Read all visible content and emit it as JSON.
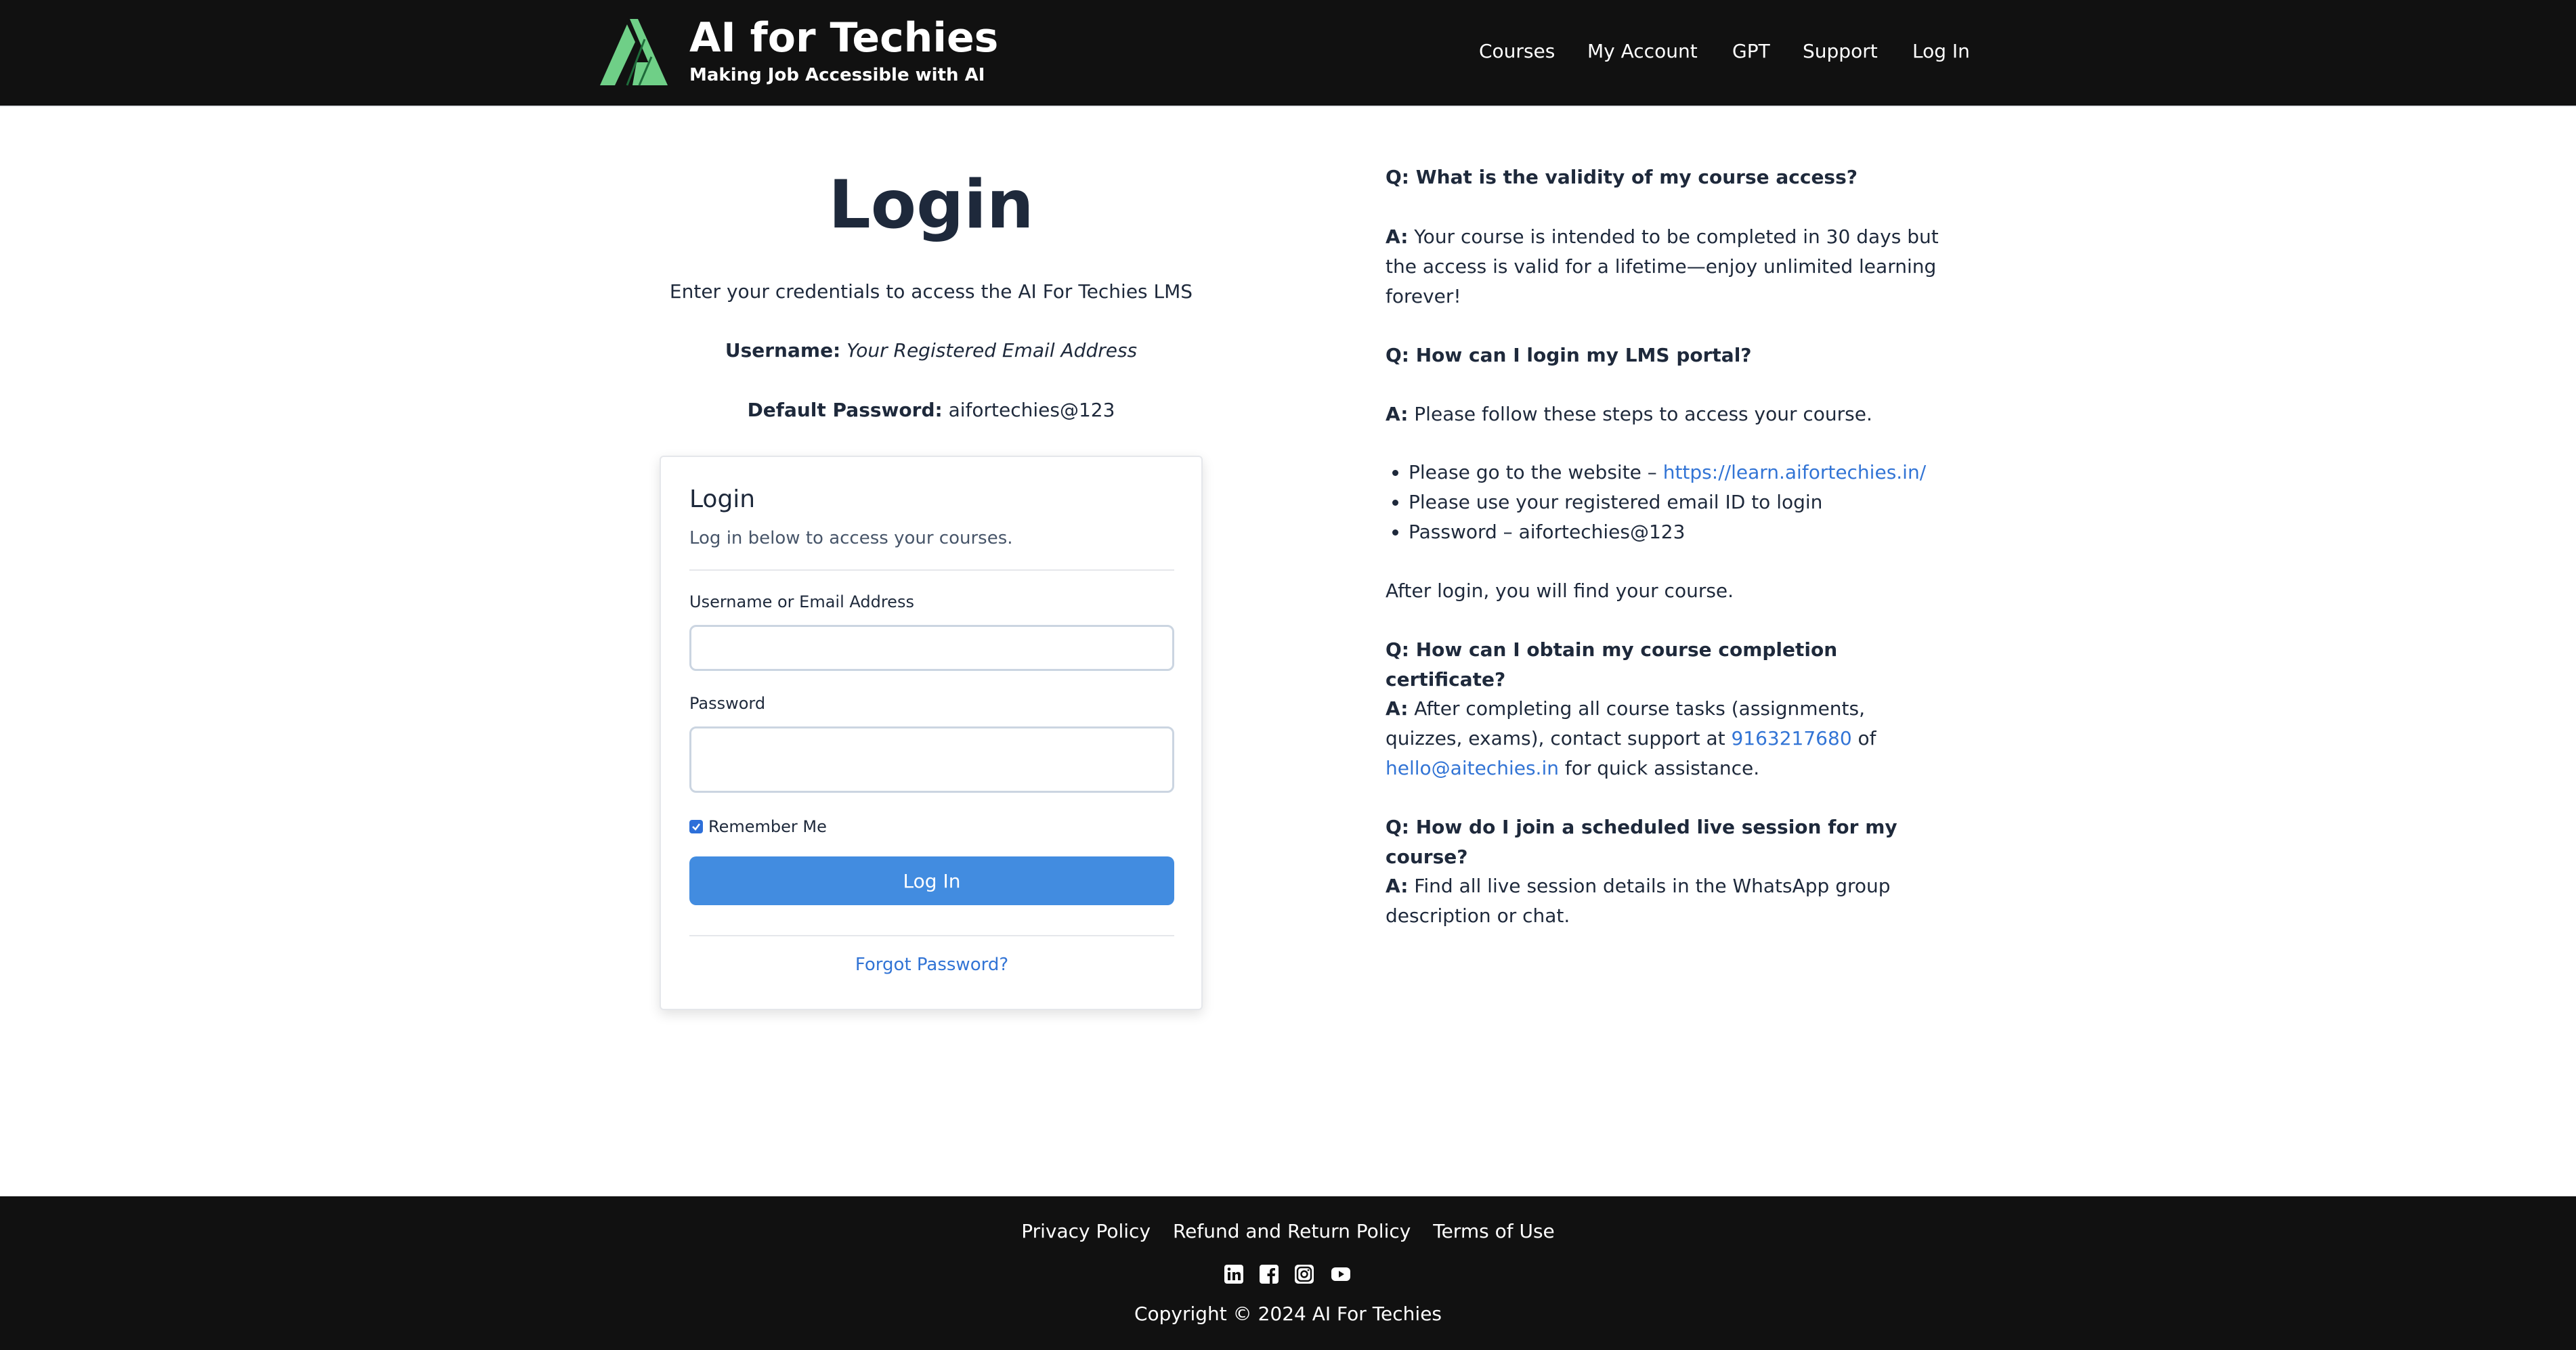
{
  "header": {
    "brand": "AI for Techies",
    "tagline": "Making Job Accessible with AI",
    "nav": [
      "Courses",
      "My Account",
      "GPT",
      "Support",
      "Log In"
    ]
  },
  "login_intro": {
    "title": "Login",
    "description": "Enter your credentials to access the AI For Techies LMS",
    "username_label": "Username:",
    "username_value": "Your Registered Email Address",
    "password_label": "Default Password:",
    "password_value": "aifortechies@123"
  },
  "login_form": {
    "title": "Login",
    "subtitle": "Log in below to access your courses.",
    "username_field_label": "Username or Email Address",
    "username_value": "",
    "password_field_label": "Password",
    "password_value": "",
    "remember_label": "Remember Me",
    "remember_checked": true,
    "submit_label": "Log In",
    "forgot_label": "Forgot Password?"
  },
  "faq": {
    "q1": "Q: What is the validity of my course access?",
    "a_prefix": "A:",
    "a1": "Your course is intended to be completed in 30 days but the access is valid for a lifetime—enjoy unlimited learning forever!",
    "q2": "Q: How can I login my LMS portal?",
    "a2": "Please follow these steps to access your course.",
    "steps": {
      "step1_text": "Please go to the website – ",
      "step1_link": "https://learn.aifortechies.in/",
      "step2": "Please use your registered email ID to login",
      "step3": "Password – aifortechies@123"
    },
    "after_login": "After login, you will find your course.",
    "q3": "Q: How can I obtain my course completion certificate?",
    "a3_text1": "After completing all course tasks (assignments, quizzes, exams), contact support at ",
    "a3_phone": "9163217680",
    "a3_text2": " of ",
    "a3_email": "hello@aitechies.in",
    "a3_text3": " for quick assistance.",
    "q4": "Q: How do I join a scheduled live session for my course?",
    "a4": "Find all live session details in the WhatsApp group description or chat."
  },
  "footer": {
    "links": [
      "Privacy Policy",
      "Refund and Return Policy",
      "Terms of Use"
    ],
    "socials": [
      "linkedin-icon",
      "facebook-icon",
      "instagram-icon",
      "youtube-icon"
    ],
    "copyright": "Copyright © 2024 AI For Techies"
  },
  "colors": {
    "header_bg": "#111111",
    "primary_button": "#428ce0",
    "link": "#3274d5",
    "logo_green": "#6fcf87",
    "text_dark": "#1e293b"
  }
}
